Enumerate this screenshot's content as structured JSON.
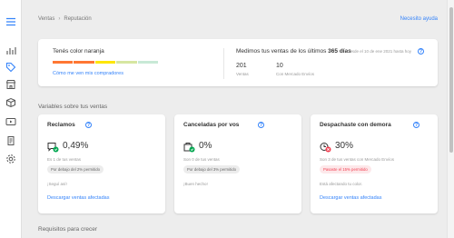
{
  "sidebar": {
    "icons": [
      "menu-icon",
      "bar-chart-icon",
      "tag-icon",
      "store-icon",
      "box-icon",
      "video-icon",
      "document-icon",
      "gear-icon"
    ]
  },
  "breadcrumb": {
    "parent": "Ventas",
    "current": "Reputación"
  },
  "help_link": "Necesito ayuda",
  "reputation": {
    "title": "Tenés color naranja",
    "thermometer": [
      "#f8c9c6",
      "#fcdcc0",
      "#fbe8b8",
      "#e6efc2",
      "#cdebd9"
    ],
    "thermometer_active": [
      "#ff7733",
      "#ff7733",
      "#fee600",
      "#d6e6a1",
      "#c8e9d6"
    ],
    "link": "Cómo me ven mis compradores"
  },
  "sales": {
    "title_prefix": "Medimos tus ventas de los últimos",
    "title_days": "365 días",
    "since": "Desde el 10 de ene 2021 hasta hoy",
    "count": "201",
    "count_label": "Ventas",
    "envios": "10",
    "envios_label": "Con Mercado Envíos"
  },
  "section_title": "Variables sobre tus ventas",
  "section_title_2": "Requisitos para crecer",
  "metrics": [
    {
      "title": "Reclamos",
      "value": "0,49%",
      "sub": "Es 1 de tus ventas",
      "pill": "Por debajo del 2% permitido",
      "msg": "¡Seguí así!",
      "link": "Descargar ventas afectadas"
    },
    {
      "title": "Canceladas por vos",
      "value": "0%",
      "sub": "Son 0 de tus ventas",
      "pill": "Por debajo del 3% permitido",
      "msg": "¡Buen hecho!",
      "link": ""
    },
    {
      "title": "Despachaste con demora",
      "value": "30%",
      "sub": "Son 3 de tus ventas con Mercado Envíos",
      "pill": "Pasaste el 15% permitido",
      "msg": "Está afectando tu color.",
      "link": "Descargar ventas afectadas"
    }
  ],
  "colors": {
    "accent": "#3483fa",
    "ok": "#00a650",
    "bad": "#f23d4f"
  }
}
